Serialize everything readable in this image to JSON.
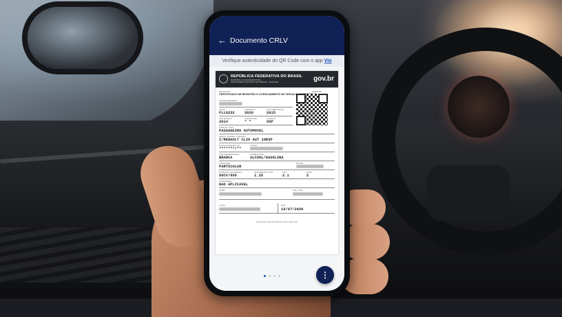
{
  "app": {
    "title": "Documento CRLV",
    "verify_text": "Verifique autenticidade do QR Code com o app ",
    "verify_link": "Vio"
  },
  "document": {
    "header": {
      "republic": "REPÚBLICA FEDERATIVA DO BRASIL",
      "sub1": "MINISTÉRIO DA INFRAESTRUTURA",
      "sub2": "DEPARTAMENTO NACIONAL DE TRÂNSITO - SENATRAN",
      "brand": "gov.br"
    },
    "detran_label": "DETRAN-SP",
    "number_label": "000000000",
    "title": "CERTIFICADO DE REGISTRO E LICENCIAMENTO DE VEÍCULO - ELETRÔNICO",
    "renavam_label": "CÓDIGO RENAVAM",
    "renavam_value": "",
    "placa_label": "PLACA",
    "placa_value": "FLL0232",
    "exercicio_label": "EXERCÍCIO",
    "exercicio_value": "2020",
    "ano_fab_label": "ANO FABRICAÇÃO",
    "ano_fab_value": "2015",
    "ano_mod_label": "ANO MODELO",
    "ano_mod_value": "2014",
    "capacidade_label": "CAPACIDADE",
    "capacidade_value": "* *",
    "lotacao_label": "LOTAÇÃO",
    "lotacao_value": "05P",
    "especie_label": "ESPÉCIE / TIPO",
    "especie_value": "PASSAGEIRO AUTOMOVEL",
    "marca_label": "MARCA / MODELO / VERSÃO",
    "marca_value": "I/RENAULT CLIO AUT 10R3P",
    "placa_ant_label": "PLACA ANTERIOR / UF",
    "placa_ant_value": "*******/**",
    "chassi_label": "CHASSI",
    "cor_label": "COR PREDOMINANTE",
    "cor_value": "BRANCA",
    "combustivel_label": "COMBUSTÍVEL",
    "combustivel_value": "ALCOOL/GASOLINA",
    "categoria_label": "CATEGORIA",
    "categoria_value": "PARTICULAR",
    "motor_label": "MOTOR",
    "potencia_label": "POTÊNCIA / CILINDRADA",
    "potencia_value": "89CV/999",
    "peso_label": "PESO BRUTO TOTAL",
    "peso_value": "1.35",
    "cmt_label": "CMT",
    "cmt_value": "2.1",
    "eixos_label": "EIXOS",
    "eixos_value": "2",
    "carroceria_label": "CARROCERIA",
    "carroceria_value": "NAO APLICAVEL",
    "nome_label": "NOME",
    "cpf_label": "CPF / CNPJ",
    "local_label": "LOCAL",
    "data_label": "DATA",
    "data_value": "16/07/2020",
    "footer": "ASSINADO DIGITALMENTE PELO DETRAN"
  },
  "pager": {
    "count": 4,
    "active": 0
  },
  "colors": {
    "appbar": "#102156",
    "link": "#1351b4"
  },
  "icons": {
    "back": "arrow-left-icon",
    "menu": "more-vertical-icon"
  }
}
